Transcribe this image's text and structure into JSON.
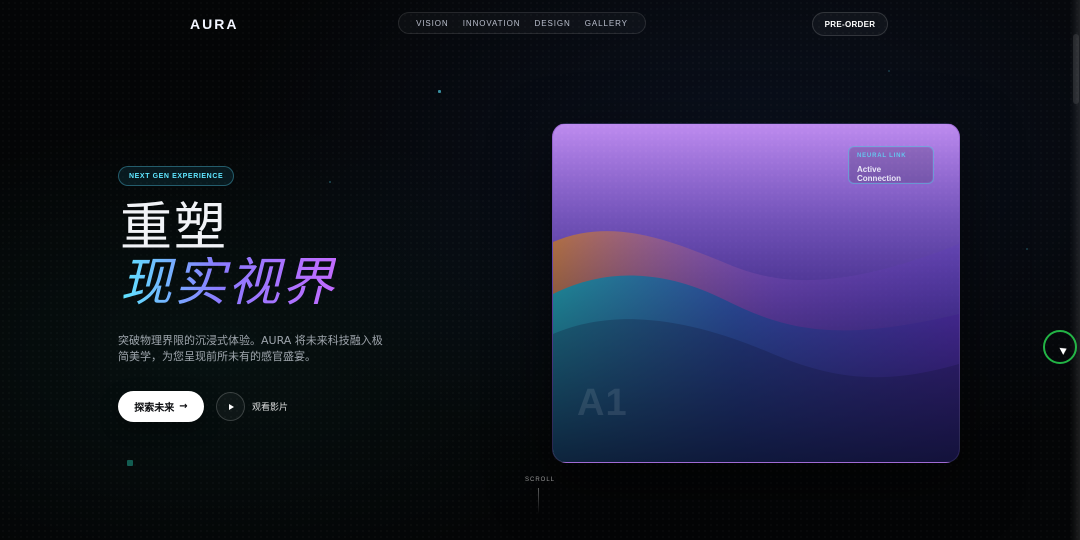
{
  "header": {
    "brand": "AURA",
    "nav": [
      "VISION",
      "INNOVATION",
      "DESIGN",
      "GALLERY"
    ],
    "cta": "PRE-ORDER"
  },
  "hero": {
    "badge": "NEXT GEN EXPERIENCE",
    "title_line1": "重塑",
    "title_line2": "现实视界",
    "description": "突破物理界限的沉浸式体验。AURA 将未来科技融入极简美学，为您呈现前所未有的感官盛宴。",
    "primary_button": {
      "label": "探索未来",
      "icon": "arrow-right-icon"
    },
    "secondary_button": {
      "label": "观看影片",
      "icon": "play-icon"
    }
  },
  "visual": {
    "overlay_card": {
      "kicker": "NEURAL LINK",
      "value": "Active Connection"
    },
    "watermark": "A1"
  },
  "scroll": {
    "label": "SCROLL"
  },
  "colors": {
    "accent_cyan": "#5fe6ff",
    "accent_purple": "#8a7cff",
    "accent_magenta": "#c26bff",
    "background": "#040506"
  }
}
